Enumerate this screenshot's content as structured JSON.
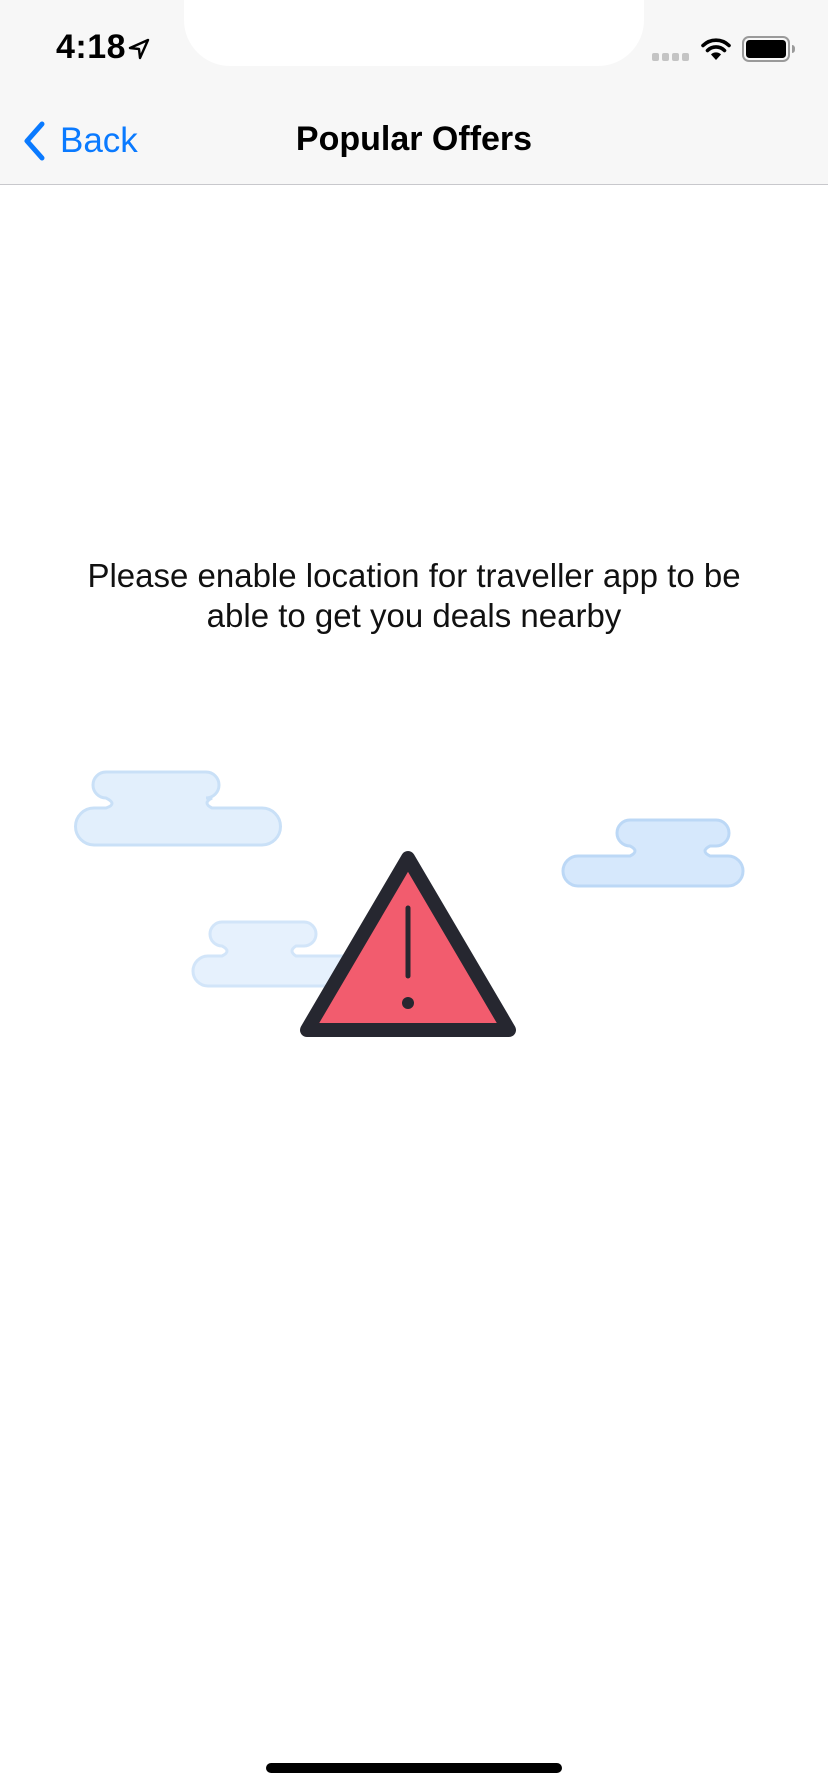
{
  "status_bar": {
    "time": "4:18",
    "icons": [
      "location-arrow-icon",
      "cellular-signal-icon",
      "wifi-icon",
      "battery-icon"
    ]
  },
  "nav": {
    "back_label": "Back",
    "title": "Popular Offers"
  },
  "content": {
    "message": "Please enable location for traveller app to be able to get you deals nearby",
    "illustration_icons": [
      "cloud-icon",
      "warning-triangle-icon"
    ]
  },
  "colors": {
    "accent": "#0a7aff",
    "warning_fill": "#f25c6e",
    "warning_stroke": "#262730",
    "cloud_fill": "#dcebfb",
    "cloud_stroke": "#c2dcf6",
    "header_bg": "#f7f7f7"
  }
}
